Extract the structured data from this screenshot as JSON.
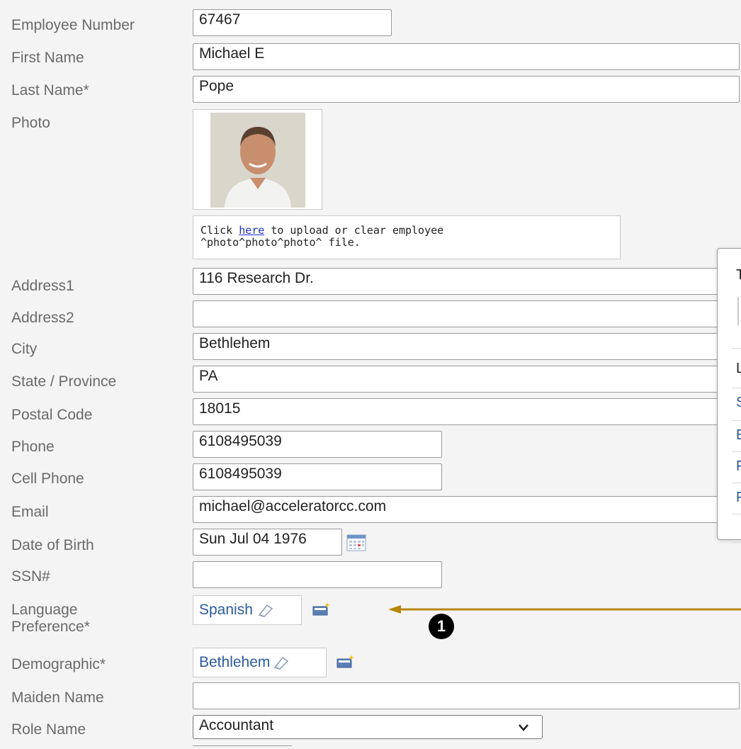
{
  "form": {
    "employee_number": {
      "label": "Employee Number",
      "value": "67467"
    },
    "first_name": {
      "label": "First Name",
      "value": "Michael E"
    },
    "last_name": {
      "label": "Last Name",
      "required": "*",
      "value": "Pope"
    },
    "photo": {
      "label": "Photo",
      "upload_text_prefix": "Click ",
      "upload_link": "here",
      "upload_text_suffix": " to upload or clear employee",
      "upload_text_line2": "^photo^photo^photo^ file."
    },
    "address1": {
      "label": "Address1",
      "value": "116 Research Dr."
    },
    "address2": {
      "label": "Address2",
      "value": ""
    },
    "city": {
      "label": "City",
      "value": "Bethlehem"
    },
    "state": {
      "label": "State / Province",
      "value": "PA"
    },
    "postal_code": {
      "label": "Postal Code",
      "value": "18015"
    },
    "phone": {
      "label": "Phone",
      "value": "6108495039"
    },
    "cell_phone": {
      "label": "Cell Phone",
      "value": "6108495039"
    },
    "email": {
      "label": "Email",
      "value": "michael@acceleratorcc.com"
    },
    "dob": {
      "label": "Date of Birth",
      "value": "Sun Jul 04 1976"
    },
    "ssn": {
      "label": "SSN#",
      "value": ""
    },
    "language": {
      "label_line1": "Language",
      "label_line2": "Preference",
      "required": "*",
      "value": "Spanish"
    },
    "demographic": {
      "label": "Demographic",
      "required": "*",
      "value": "Bethlehem"
    },
    "maiden_name": {
      "label": "Maiden Name",
      "value": ""
    },
    "role_name": {
      "label": "Role Name",
      "value": "Accountant"
    }
  },
  "side_panel": {
    "letters": [
      "T",
      "L",
      "S",
      "E",
      "F",
      "F"
    ]
  },
  "annotation": {
    "number": "1",
    "color": "#b8860b"
  }
}
